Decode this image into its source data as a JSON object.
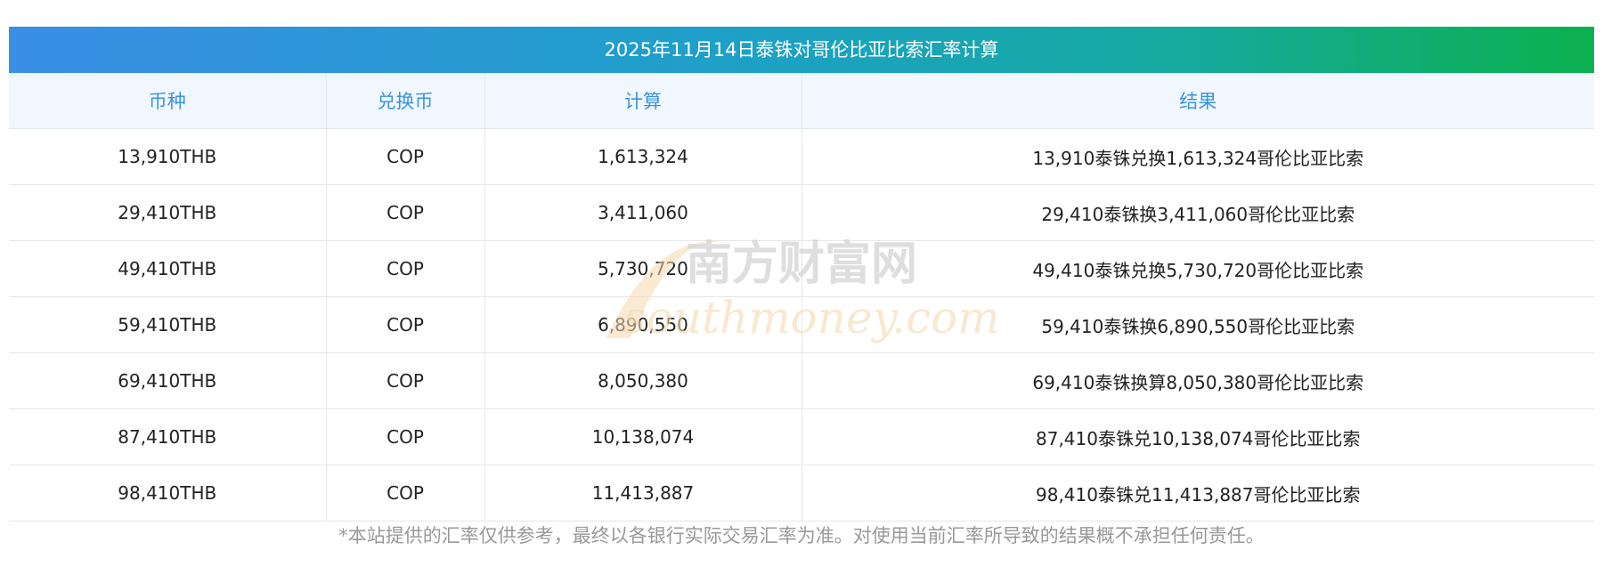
{
  "title": "2025年11月14日泰铢对哥伦比亚比索汇率计算",
  "headers": [
    "币种",
    "兑换币",
    "计算",
    "结果"
  ],
  "rows": [
    [
      "13,910THB",
      "COP",
      "1,613,324",
      "13,910泰铢兑换1,613,324哥伦比亚比索"
    ],
    [
      "29,410THB",
      "COP",
      "3,411,060",
      "29,410泰铢换3,411,060哥伦比亚比索"
    ],
    [
      "49,410THB",
      "COP",
      "5,730,720",
      "49,410泰铢兑换5,730,720哥伦比亚比索"
    ],
    [
      "59,410THB",
      "COP",
      "6,890,550",
      "59,410泰铢换6,890,550哥伦比亚比索"
    ],
    [
      "69,410THB",
      "COP",
      "8,050,380",
      "69,410泰铢换算8,050,380哥伦比亚比索"
    ],
    [
      "87,410THB",
      "COP",
      "10,138,074",
      "87,410泰铢兑10,138,074哥伦比亚比索"
    ],
    [
      "98,410THB",
      "COP",
      "11,413,887",
      "98,410泰铢兑11,413,887哥伦比亚比索"
    ]
  ],
  "watermark": {
    "cn": "南方财富网",
    "en": "southmoney.com"
  },
  "footnote": "*本站提供的汇率仅供参考，最终以各银行实际交易汇率为准。对使用当前汇率所导致的结果概不承担任何责任。",
  "colors": {
    "title_gradient_start": "#3a8ee6",
    "title_gradient_end": "#0bb14e",
    "header_bg": "#f1f7fe",
    "header_text": "#3a93e0",
    "watermark": "#f5d9b0"
  }
}
